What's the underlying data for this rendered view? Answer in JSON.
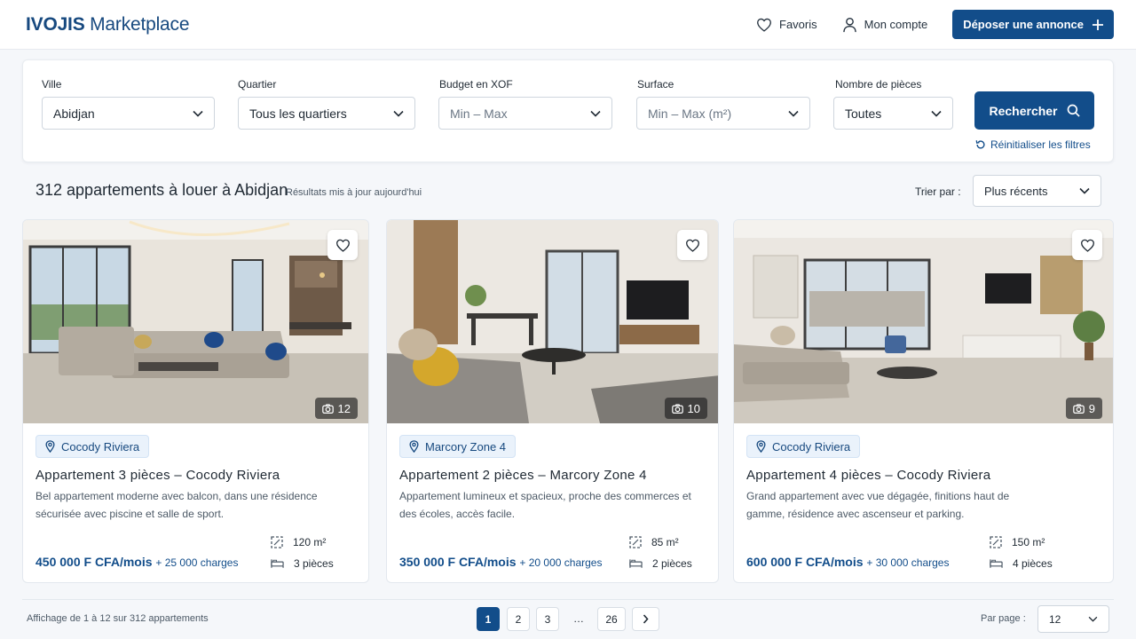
{
  "header": {
    "logo_bold": "IVOJIS",
    "logo_rest": " Marketplace",
    "favorites": "Favoris",
    "account": "Mon compte",
    "post_button": "Déposer une annonce"
  },
  "filters": {
    "city": {
      "label": "Ville",
      "value": "Abidjan"
    },
    "district": {
      "label": "Quartier",
      "value": "Tous les quartiers"
    },
    "budget": {
      "label": "Budget en XOF",
      "value": "Min – Max"
    },
    "surface": {
      "label": "Surface",
      "value": "Min – Max (m²)"
    },
    "rooms": {
      "label": "Nombre de pièces",
      "value": "Toutes"
    },
    "search_button": "Rechercher",
    "reset": "Réinitialiser les filtres"
  },
  "results": {
    "title": "312 appartements à louer à Abidjan",
    "subtitle": "Résultats mis à jour aujourd'hui",
    "sort_label": "Trier par :",
    "sort_value": "Plus récents"
  },
  "listings": [
    {
      "location": "Cocody Riviera",
      "title": "Appartement 3 pièces – Cocody Riviera",
      "description": "Bel appartement moderne avec balcon, dans une résidence sécurisée avec piscine et salle de sport.",
      "price": "450 000 F CFA/mois",
      "charges": "+ 25 000 charges",
      "surface": "120 m²",
      "rooms": "3 pièces",
      "photo_count": "12"
    },
    {
      "location": "Marcory Zone 4",
      "title": "Appartement 2 pièces – Marcory Zone 4",
      "description": "Appartement lumineux et spacieux, proche des commerces et des écoles, accès facile.",
      "price": "350 000 F CFA/mois",
      "charges": "+ 20 000 charges",
      "surface": "85 m²",
      "rooms": "2 pièces",
      "photo_count": "10"
    },
    {
      "location": "Cocody Riviera",
      "title": "Appartement 4 pièces – Cocody Riviera",
      "description": "Grand appartement avec vue dégagée, finitions haut de gamme, résidence avec ascenseur et parking.",
      "price": "600 000 F CFA/mois",
      "charges": "+ 30 000 charges",
      "surface": "150 m²",
      "rooms": "4 pièces",
      "photo_count": "9"
    }
  ],
  "footer": {
    "showing": "Affichage de 1 à 12 sur 312 appartements",
    "pages": [
      "1",
      "2",
      "3",
      "26"
    ],
    "ellipsis": "…",
    "per_page_label": "Par page :",
    "per_page_value": "12"
  },
  "colors": {
    "primary": "#124d8a",
    "accent_bg": "#eaf2fb"
  }
}
